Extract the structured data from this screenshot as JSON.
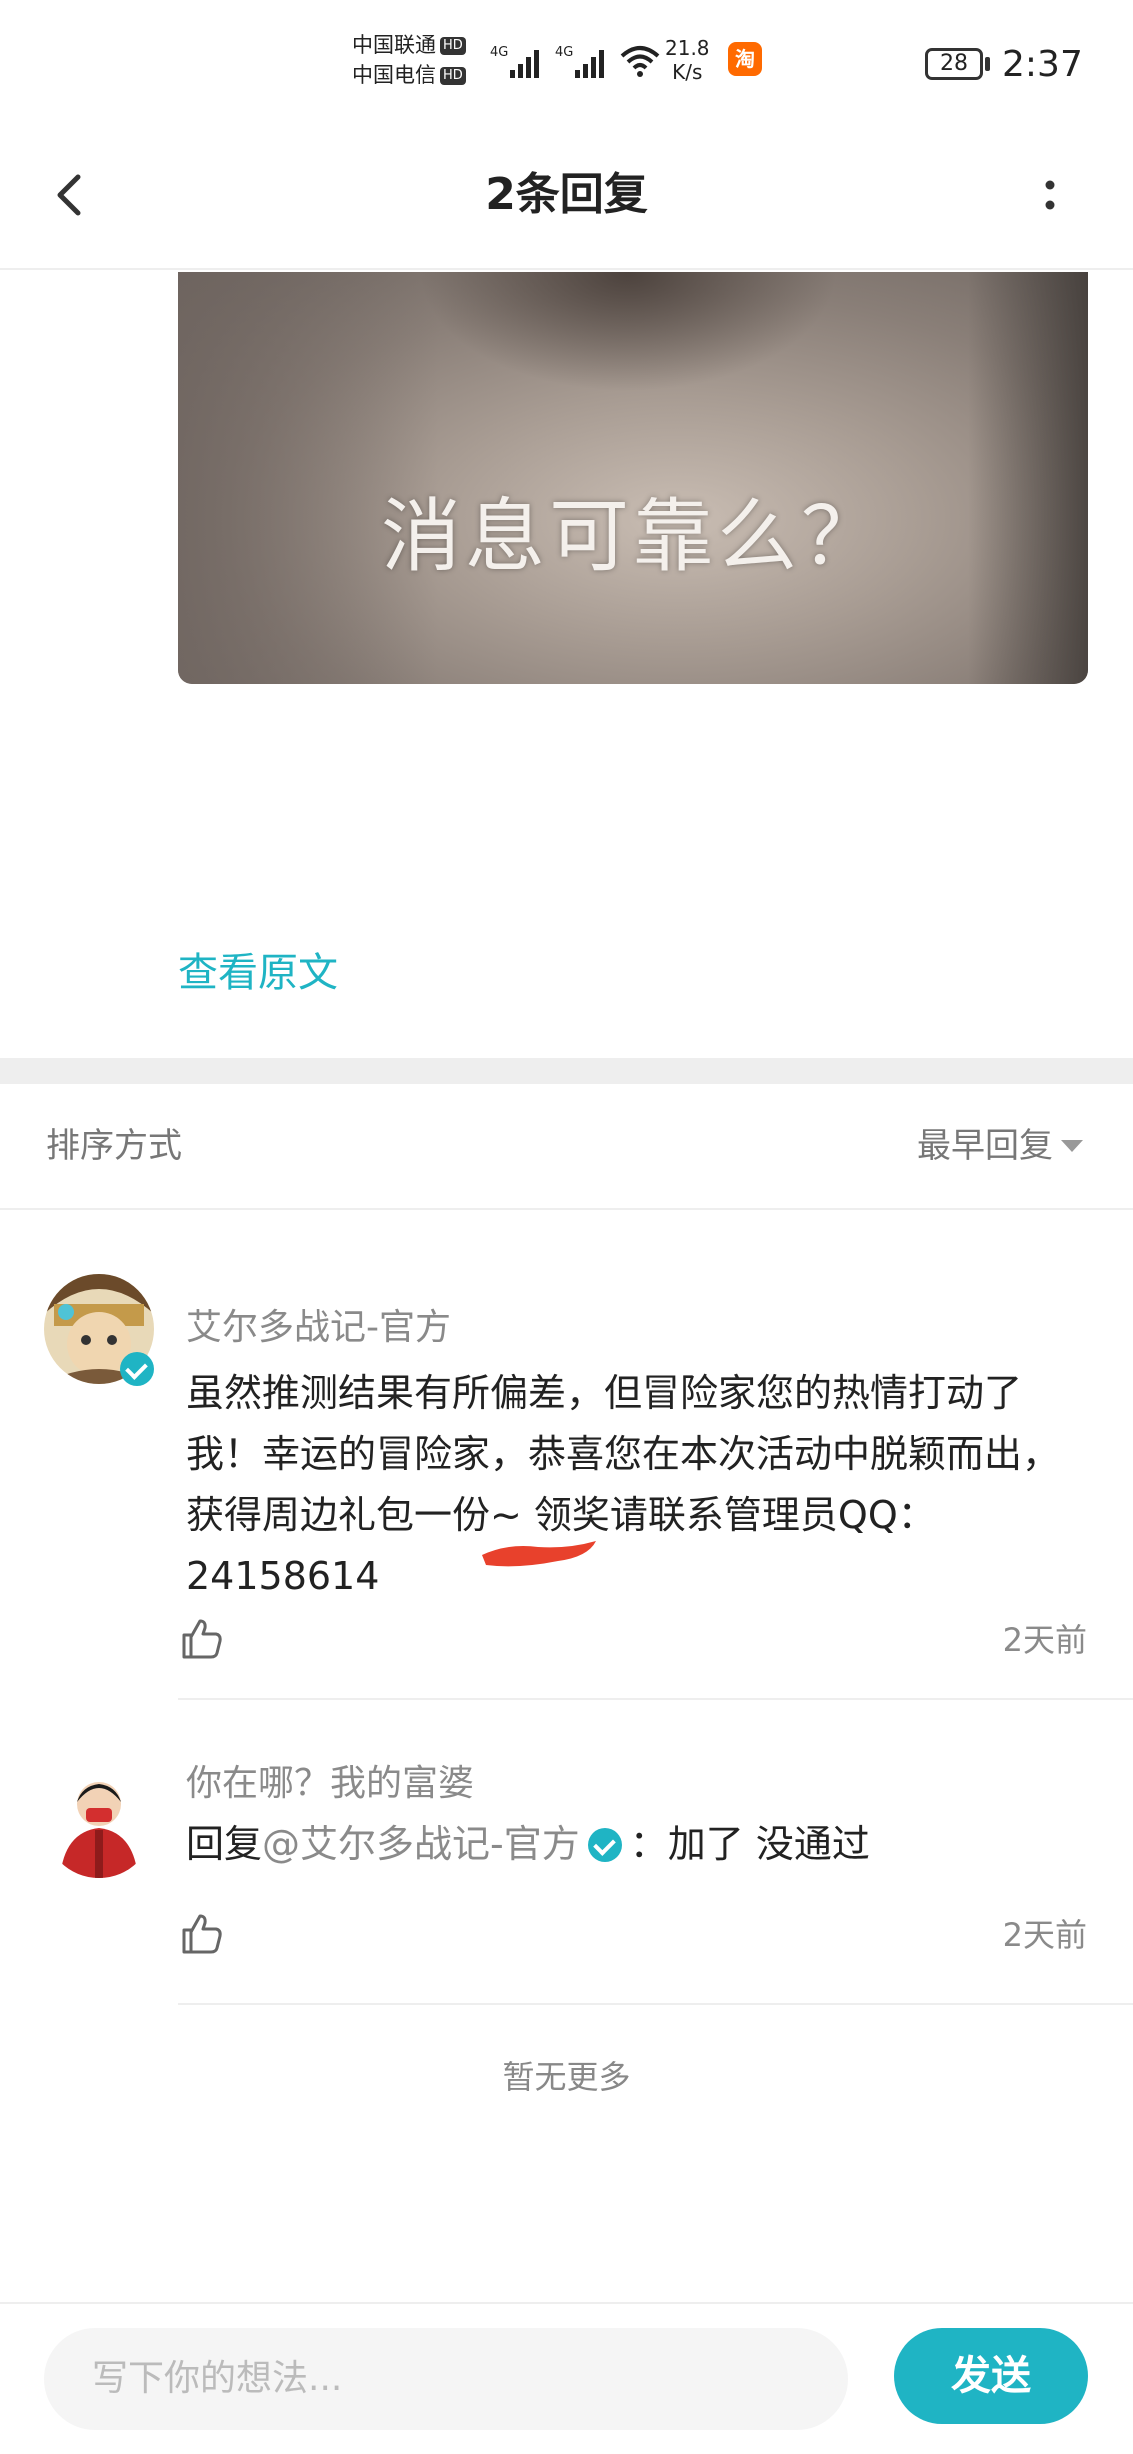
{
  "status_bar": {
    "carrier_1": "中国联通",
    "carrier_2": "中国电信",
    "hd_badge": "HD",
    "network_1": "4G",
    "network_2": "4G",
    "speed_value": "21.8",
    "speed_unit": "K/s",
    "app_badge": "淘",
    "battery": "28",
    "time": "2:37"
  },
  "header": {
    "title": "2条回复",
    "back_icon": "chevron-left-icon",
    "more_icon": "more-vertical-icon"
  },
  "post": {
    "image_caption": "消息可靠么？",
    "view_original": "查看原文"
  },
  "sort": {
    "label": "排序方式",
    "value": "最早回复"
  },
  "comments": [
    {
      "username": "艾尔多战记-官方",
      "verified": true,
      "text": "虽然推测结果有所偏差，但冒险家您的热情打动了我！幸运的冒险家，恭喜您在本次活动中脱颖而出，获得周边礼包一份~ 领奖请联系管理员QQ：24158614",
      "time": "2天前"
    },
    {
      "username": "你在哪？我的富婆",
      "reply_prefix": "回复",
      "mention": "@艾尔多战记-官方",
      "reply_text": "：加了 没通过",
      "time": "2天前"
    }
  ],
  "no_more": "暂无更多",
  "bottom_bar": {
    "input_placeholder": "写下你的想法...",
    "send_label": "发送"
  },
  "colors": {
    "accent": "#1fb4c4",
    "muted_text": "#8a8a8a",
    "divider": "#eeeeee"
  }
}
